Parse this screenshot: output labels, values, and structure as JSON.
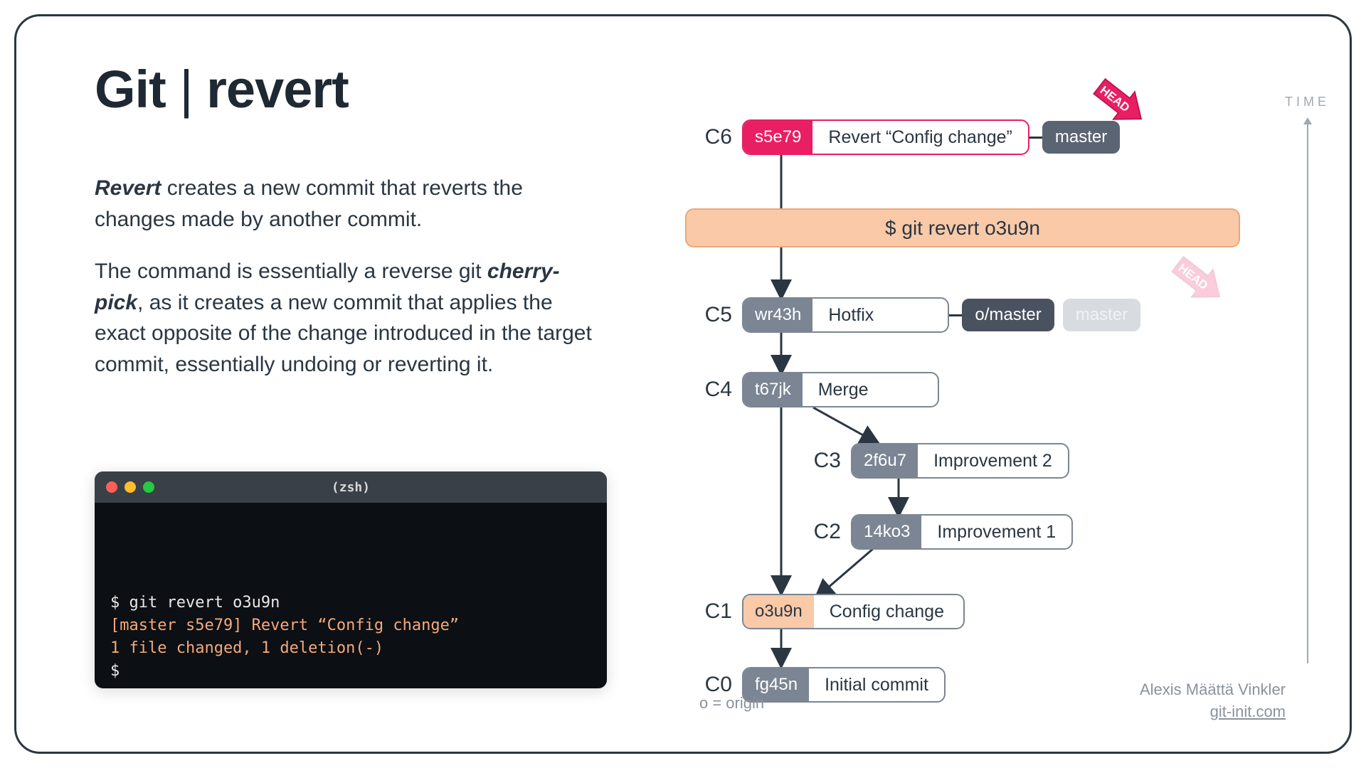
{
  "title_prefix": "Git",
  "title_sep": " | ",
  "title_cmd": "revert",
  "para1_bold": "Revert",
  "para1_rest": " creates a new commit that reverts the changes made by another commit.",
  "para2_a": "The command is essentially a reverse git ",
  "para2_bold": "cherry-pick",
  "para2_b": ", as it creates a new commit that applies the exact opposite of the change introduced in the target commit, essentially undoing or reverting it.",
  "terminal": {
    "shell": "(zsh)",
    "line1": "$ git revert o3u9n",
    "line2": "[master s5e79] Revert “Config change”",
    "line3": "1 file changed, 1 deletion(-)",
    "line4": "$"
  },
  "cmdbar": "$ git revert o3u9n",
  "commits": {
    "c6": {
      "label": "C6",
      "hash": "s5e79",
      "msg": "Revert “Config change”"
    },
    "c5": {
      "label": "C5",
      "hash": "wr43h",
      "msg": "Hotfix"
    },
    "c4": {
      "label": "C4",
      "hash": "t67jk",
      "msg": "Merge"
    },
    "c3": {
      "label": "C3",
      "hash": "2f6u7",
      "msg": "Improvement 2"
    },
    "c2": {
      "label": "C2",
      "hash": "14ko3",
      "msg": "Improvement 1"
    },
    "c1": {
      "label": "C1",
      "hash": "o3u9n",
      "msg": "Config change"
    },
    "c0": {
      "label": "C0",
      "hash": "fg45n",
      "msg": "Initial commit"
    }
  },
  "tags": {
    "master": "master",
    "omaster": "o/master",
    "master_faded": "master"
  },
  "head_label": "HEAD",
  "origin_note": "o = origin",
  "time_label": "TIME",
  "credit_name": "Alexis Määttä Vinkler",
  "credit_url": "git-init.com"
}
